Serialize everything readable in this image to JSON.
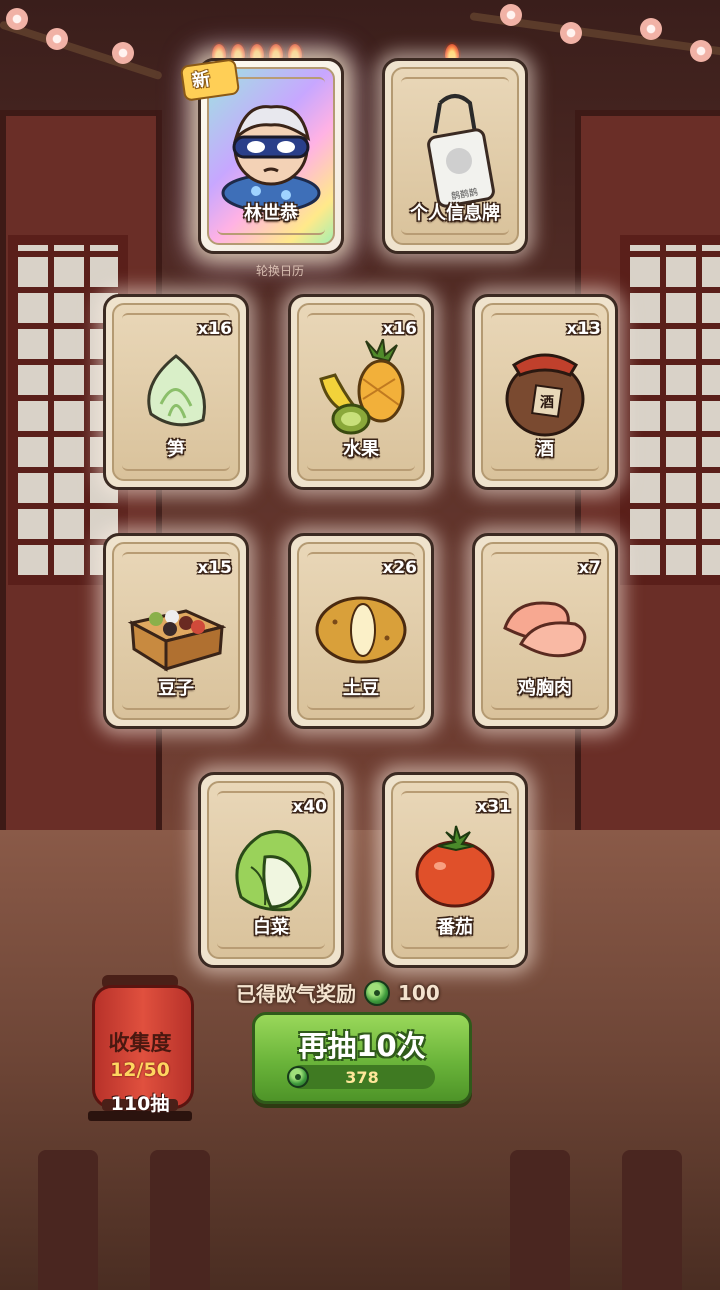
{
  "top_cards": [
    {
      "label": "林世恭",
      "flames": 5,
      "is_new": true,
      "new_badge": "新",
      "icon": "masked-character-icon"
    },
    {
      "label": "个人信息牌",
      "flames": 1,
      "is_new": false,
      "icon": "name-tag-icon",
      "tag_text": "鹊鹊鹊"
    }
  ],
  "sub_caption": "轮换日历",
  "item_cards": [
    {
      "label": "笋",
      "count": "x16",
      "icon": "bamboo-shoot-icon"
    },
    {
      "label": "水果",
      "count": "x16",
      "icon": "fruit-basket-icon"
    },
    {
      "label": "酒",
      "count": "x13",
      "icon": "wine-jar-icon",
      "jar_text": "酒"
    },
    {
      "label": "豆子",
      "count": "x15",
      "icon": "beans-box-icon"
    },
    {
      "label": "土豆",
      "count": "x26",
      "icon": "potato-icon"
    },
    {
      "label": "鸡胸肉",
      "count": "x7",
      "icon": "chicken-breast-icon"
    },
    {
      "label": "白菜",
      "count": "x40",
      "icon": "cabbage-icon"
    },
    {
      "label": "番茄",
      "count": "x31",
      "icon": "tomato-icon"
    }
  ],
  "reward": {
    "text": "已得欧气奖励",
    "value": "100"
  },
  "draw_button": {
    "label": "再抽10次",
    "cost": "378"
  },
  "collection": {
    "title": "收集度",
    "progress": "12/50",
    "draws": "110抽"
  },
  "colors": {
    "button_green": "#6ab43a",
    "lantern_red": "#d0443a",
    "card_bg": "#e9d7b8",
    "cost_yellow": "#ffe79a"
  }
}
